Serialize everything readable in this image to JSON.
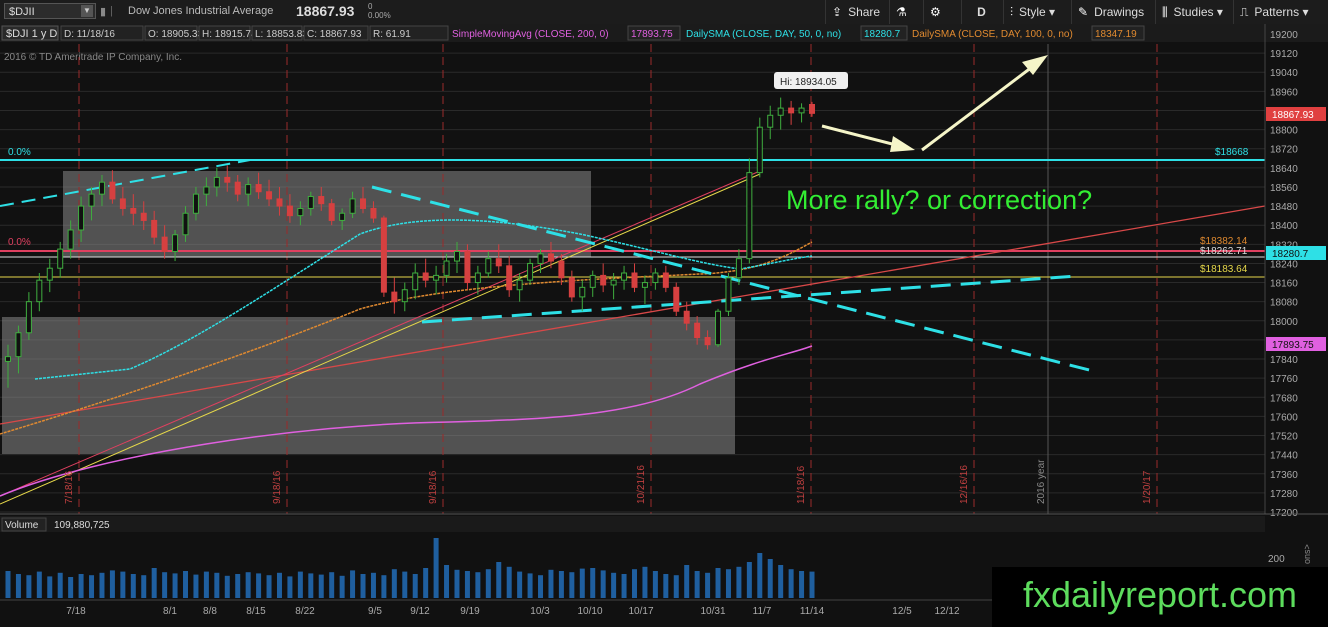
{
  "toolbar": {
    "symbol": "$DJII",
    "name": "Dow Jones Industrial Average",
    "price": "18867.93",
    "change": "0",
    "change_pct": "0.00%",
    "share": "Share",
    "period": "D",
    "style": "Style",
    "drawings": "Drawings",
    "studies": "Studies",
    "patterns": "Patterns"
  },
  "info_bar": {
    "symbol": "$DJI 1 y D",
    "date": "D: 11/18/16",
    "open": "O: 18905.33",
    "high": "H: 18915.74",
    "low": "L: 18853.83",
    "close": "C: 18867.93",
    "range": "R: 61.91",
    "sma200_label": "SimpleMovingAvg (CLOSE, 200, 0)",
    "sma200_value": "17893.75",
    "sma50_label": "DailySMA (CLOSE, DAY, 50, 0, no)",
    "sma50_value": "18280.7",
    "sma100_label": "DailySMA (CLOSE, DAY, 100, 0, no)",
    "sma100_value": "18347.19",
    "copyright": "2016 © TD Ameritrade IP Company, Inc."
  },
  "annotations": {
    "question": "More rally? or correction?",
    "high_callout": "Hi: 18934.05",
    "fib_top": "0.0%",
    "fib_mid": "0.0%",
    "fib_top_value": "$18668",
    "level_1": "$18382.14",
    "level_2": "$18262.71",
    "level_3": "$18183.64"
  },
  "price_tags": {
    "last": "18867.93",
    "sma50": "18280.7",
    "sma200": "17893.75"
  },
  "volume": {
    "label": "Volume",
    "value": "109,880,725",
    "axis_label": "200",
    "side_label": "ons>"
  },
  "watermark": "fxdailyreport.com",
  "colors": {
    "bg": "#111111",
    "grid": "#2a2a2a",
    "up": "#3fae3f",
    "down": "#d64040",
    "cyan": "#2ee0e6",
    "magenta": "#e060e0",
    "orange": "#e08a30",
    "yellow": "#e6d84a",
    "green_text": "#33ee33",
    "volume": "#1f5f9f"
  },
  "chart_data": {
    "type": "candlestick",
    "y_ticks": [
      19200,
      19120,
      19040,
      18960,
      18880,
      18800,
      18720,
      18640,
      18560,
      18480,
      18400,
      18320,
      18240,
      18160,
      18080,
      18000,
      17920,
      17840,
      17760,
      17680,
      17600,
      17520,
      17440,
      17360,
      17280,
      17200
    ],
    "ylim": [
      17200,
      19200
    ],
    "x_labels": [
      "7/18",
      "8/1",
      "8/8",
      "8/15",
      "8/22",
      "9/5",
      "9/12",
      "9/19",
      "10/3",
      "10/10",
      "10/17",
      "10/31",
      "11/7",
      "11/14",
      "12/5",
      "12/12"
    ],
    "event_labels": [
      "7/18/16",
      "9/18/16",
      "9/18/16",
      "10/21/16",
      "11/18/16",
      "12/16/16",
      "2016 year",
      "1/20/17"
    ],
    "candles": [
      [
        17830,
        17900,
        17720,
        17850
      ],
      [
        17850,
        17980,
        17780,
        17950
      ],
      [
        17950,
        18120,
        17920,
        18080
      ],
      [
        18080,
        18200,
        18040,
        18170
      ],
      [
        18170,
        18260,
        18120,
        18220
      ],
      [
        18220,
        18330,
        18180,
        18300
      ],
      [
        18300,
        18420,
        18260,
        18380
      ],
      [
        18380,
        18520,
        18330,
        18480
      ],
      [
        18480,
        18560,
        18420,
        18530
      ],
      [
        18530,
        18610,
        18480,
        18580
      ],
      [
        18580,
        18630,
        18490,
        18510
      ],
      [
        18510,
        18560,
        18440,
        18470
      ],
      [
        18470,
        18530,
        18400,
        18450
      ],
      [
        18450,
        18500,
        18380,
        18420
      ],
      [
        18420,
        18460,
        18320,
        18350
      ],
      [
        18350,
        18400,
        18260,
        18290
      ],
      [
        18290,
        18380,
        18250,
        18360
      ],
      [
        18360,
        18480,
        18330,
        18450
      ],
      [
        18450,
        18560,
        18420,
        18530
      ],
      [
        18530,
        18600,
        18480,
        18560
      ],
      [
        18560,
        18640,
        18520,
        18600
      ],
      [
        18600,
        18650,
        18540,
        18580
      ],
      [
        18580,
        18610,
        18500,
        18530
      ],
      [
        18530,
        18600,
        18480,
        18570
      ],
      [
        18570,
        18620,
        18510,
        18540
      ],
      [
        18540,
        18590,
        18480,
        18510
      ],
      [
        18510,
        18560,
        18440,
        18480
      ],
      [
        18480,
        18530,
        18410,
        18440
      ],
      [
        18440,
        18500,
        18400,
        18470
      ],
      [
        18470,
        18540,
        18440,
        18520
      ],
      [
        18520,
        18560,
        18460,
        18490
      ],
      [
        18490,
        18510,
        18400,
        18420
      ],
      [
        18420,
        18470,
        18380,
        18450
      ],
      [
        18450,
        18540,
        18430,
        18510
      ],
      [
        18510,
        18560,
        18450,
        18470
      ],
      [
        18470,
        18500,
        18410,
        18430
      ],
      [
        18430,
        18440,
        18100,
        18120
      ],
      [
        18120,
        18180,
        18030,
        18080
      ],
      [
        18080,
        18160,
        18040,
        18130
      ],
      [
        18130,
        18240,
        18090,
        18200
      ],
      [
        18200,
        18260,
        18140,
        18170
      ],
      [
        18170,
        18230,
        18110,
        18190
      ],
      [
        18190,
        18280,
        18160,
        18250
      ],
      [
        18250,
        18330,
        18200,
        18290
      ],
      [
        18290,
        18320,
        18130,
        18160
      ],
      [
        18160,
        18230,
        18110,
        18200
      ],
      [
        18200,
        18290,
        18180,
        18260
      ],
      [
        18260,
        18320,
        18200,
        18230
      ],
      [
        18230,
        18270,
        18100,
        18130
      ],
      [
        18130,
        18200,
        18080,
        18170
      ],
      [
        18170,
        18260,
        18150,
        18240
      ],
      [
        18240,
        18300,
        18200,
        18280
      ],
      [
        18280,
        18330,
        18220,
        18250
      ],
      [
        18250,
        18280,
        18150,
        18180
      ],
      [
        18180,
        18210,
        18080,
        18100
      ],
      [
        18100,
        18170,
        18040,
        18140
      ],
      [
        18140,
        18210,
        18100,
        18190
      ],
      [
        18190,
        18240,
        18120,
        18150
      ],
      [
        18150,
        18200,
        18090,
        18170
      ],
      [
        18170,
        18230,
        18130,
        18200
      ],
      [
        18200,
        18240,
        18120,
        18140
      ],
      [
        18140,
        18190,
        18070,
        18160
      ],
      [
        18160,
        18220,
        18130,
        18200
      ],
      [
        18200,
        18230,
        18120,
        18140
      ],
      [
        18140,
        18160,
        18020,
        18040
      ],
      [
        18040,
        18080,
        17960,
        17990
      ],
      [
        17990,
        18020,
        17900,
        17930
      ],
      [
        17930,
        17960,
        17880,
        17900
      ],
      [
        17900,
        18050,
        17890,
        18040
      ],
      [
        18040,
        18200,
        18020,
        18180
      ],
      [
        18180,
        18300,
        18150,
        18260
      ],
      [
        18260,
        18680,
        18240,
        18620
      ],
      [
        18620,
        18850,
        18600,
        18810
      ],
      [
        18810,
        18900,
        18760,
        18860
      ],
      [
        18860,
        18934,
        18800,
        18890
      ],
      [
        18890,
        18920,
        18820,
        18870
      ],
      [
        18870,
        18910,
        18830,
        18890
      ],
      [
        18905,
        18916,
        18854,
        18868
      ]
    ],
    "sma200_value": 17893.75,
    "sma50_value": 18280.7,
    "sma100_value": 18347.19,
    "high": 18934.05
  }
}
